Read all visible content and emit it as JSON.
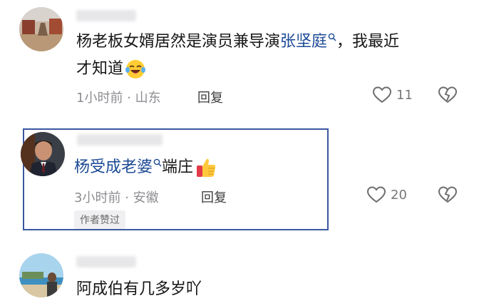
{
  "comments": [
    {
      "text_before": "杨老板女婿居然是演员兼导演",
      "link": "张坚庭",
      "text_after": "，我最近",
      "text_line2": "才知道",
      "emoji": "laughing-tears",
      "time": "1小时前 · 山东",
      "reply": "回复",
      "likes": "11"
    },
    {
      "link": "杨受成老婆",
      "text_after": "端庄",
      "emoji": "thumbs-up",
      "time": "3小时前 · 安徽",
      "reply": "回复",
      "likes": "20",
      "author_tag": "作者赞过"
    },
    {
      "text_before": "阿成伯有几多岁吖"
    }
  ],
  "colors": {
    "link": "#1c4a96",
    "highlight_border": "#3a57a0",
    "meta": "#8e8e93"
  }
}
